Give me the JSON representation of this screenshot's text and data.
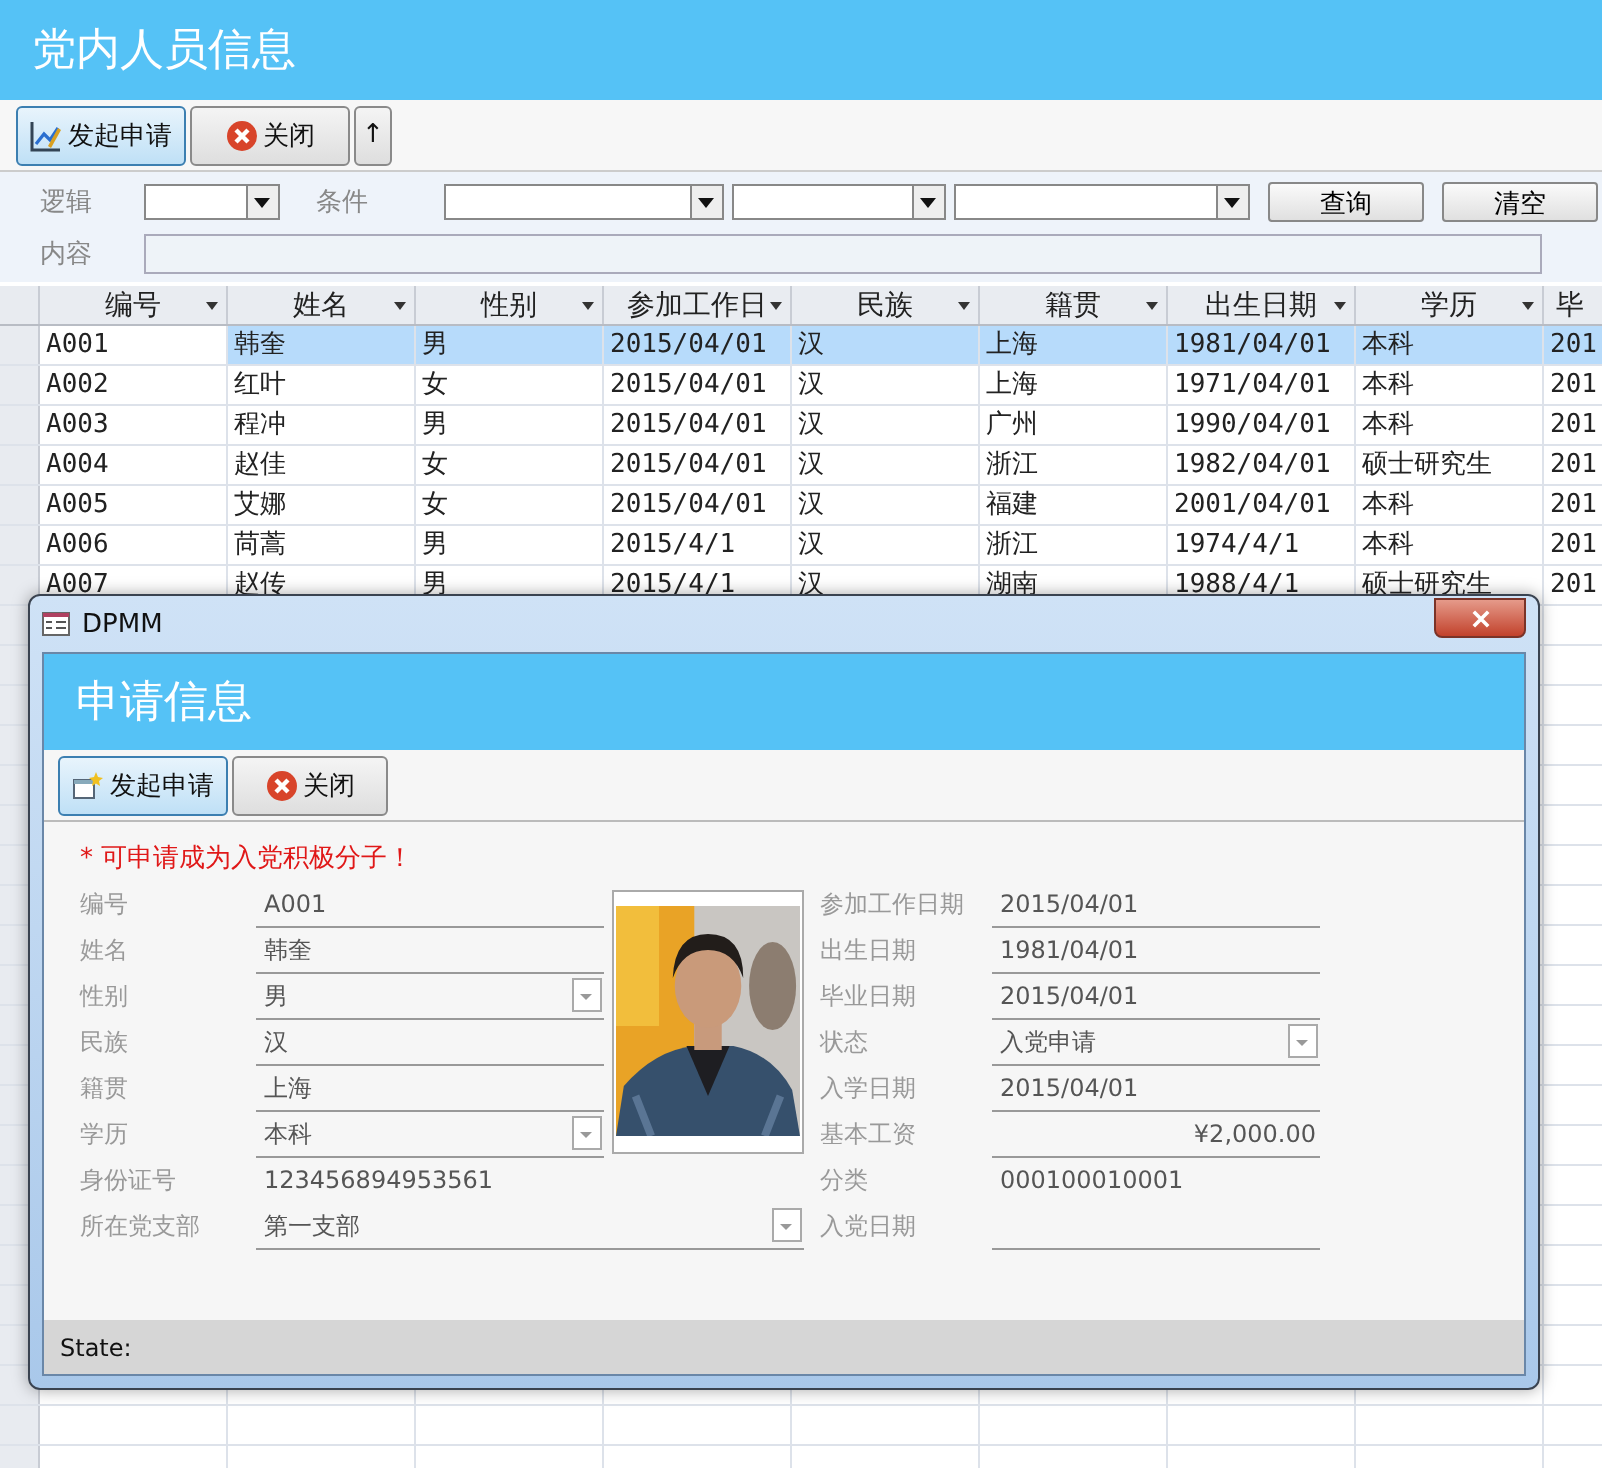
{
  "title": "党内人员信息",
  "toolbar": [
    {
      "label": "发起申请",
      "selected": true
    },
    {
      "label": "关闭",
      "selected": false
    },
    {
      "label": "↑",
      "selected": false
    }
  ],
  "filter": {
    "logic_label": "逻辑",
    "condition_label": "条件",
    "content_label": "内容",
    "buttons": [
      "查询",
      "清空"
    ]
  },
  "table": {
    "columns": [
      "编号",
      "姓名",
      "性别",
      "参加工作日",
      "民族",
      "籍贯",
      "出生日期",
      "学历",
      "毕"
    ],
    "rows": [
      {
        "selected": true,
        "cells": [
          "A001",
          "韩奎",
          "男",
          "2015/04/01",
          "汉",
          "上海",
          "1981/04/01",
          "本科",
          "201"
        ]
      },
      {
        "selected": false,
        "cells": [
          "A002",
          "红叶",
          "女",
          "2015/04/01",
          "汉",
          "上海",
          "1971/04/01",
          "本科",
          "201"
        ]
      },
      {
        "selected": false,
        "cells": [
          "A003",
          "程冲",
          "男",
          "2015/04/01",
          "汉",
          "广州",
          "1990/04/01",
          "本科",
          "201"
        ]
      },
      {
        "selected": false,
        "cells": [
          "A004",
          "赵佳",
          "女",
          "2015/04/01",
          "汉",
          "浙江",
          "1982/04/01",
          "硕士研究生",
          "201"
        ]
      },
      {
        "selected": false,
        "cells": [
          "A005",
          "艾娜",
          "女",
          "2015/04/01",
          "汉",
          "福建",
          "2001/04/01",
          "本科",
          "201"
        ]
      },
      {
        "selected": false,
        "cells": [
          "A006",
          "苘蒿",
          "男",
          "2015/4/1",
          "汉",
          "浙江",
          "1974/4/1",
          "本科",
          "201"
        ]
      },
      {
        "selected": false,
        "cells": [
          "A007",
          "赵传",
          "男",
          "2015/4/1",
          "汉",
          "湖南",
          "1988/4/1",
          "硕士研究生",
          "201"
        ]
      }
    ]
  },
  "dialog": {
    "title": "DPMM",
    "heading": "申请信息",
    "buttons": [
      {
        "label": "发起申请",
        "selected": true
      },
      {
        "label": "关闭",
        "selected": false
      }
    ],
    "notice": "* 可申请成为入党积极分子！",
    "left_fields": [
      {
        "label": "编号",
        "value": "A001",
        "kind": "text"
      },
      {
        "label": "姓名",
        "value": "韩奎",
        "kind": "text"
      },
      {
        "label": "性别",
        "value": "男",
        "kind": "combo"
      },
      {
        "label": "民族",
        "value": "汉",
        "kind": "text"
      },
      {
        "label": "籍贯",
        "value": "上海",
        "kind": "text"
      },
      {
        "label": "学历",
        "value": "本科",
        "kind": "combo"
      },
      {
        "label": "身份证号",
        "value": "123456894953561",
        "kind": "plain"
      },
      {
        "label": "所在党支部",
        "value": "第一支部",
        "kind": "combo"
      }
    ],
    "right_fields": [
      {
        "label": "参加工作日期",
        "value": "2015/04/01",
        "kind": "text"
      },
      {
        "label": "出生日期",
        "value": "1981/04/01",
        "kind": "text"
      },
      {
        "label": "毕业日期",
        "value": "2015/04/01",
        "kind": "text"
      },
      {
        "label": "状态",
        "value": "入党申请",
        "kind": "combo"
      },
      {
        "label": "入学日期",
        "value": "2015/04/01",
        "kind": "text"
      },
      {
        "label": "基本工资",
        "value": "¥2,000.00",
        "kind": "currency"
      },
      {
        "label": "分类",
        "value": "000100010001",
        "kind": "plain"
      },
      {
        "label": "入党日期",
        "kind": "text"
      }
    ],
    "status": "State:"
  }
}
